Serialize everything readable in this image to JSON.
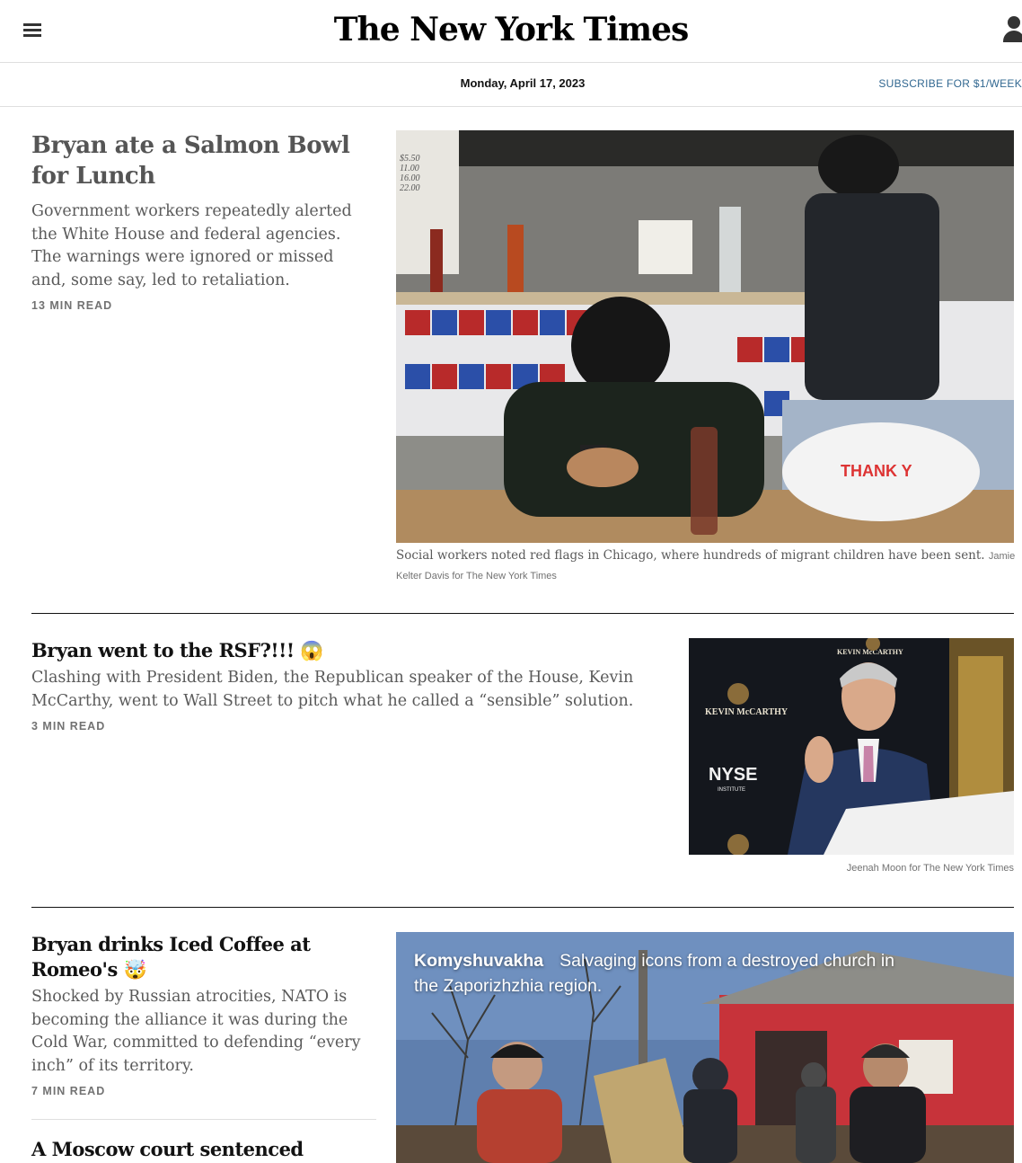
{
  "header": {
    "logo": "The New York Times",
    "date": "Monday, April 17, 2023",
    "subscribe": "SUBSCRIBE FOR $1/WEEK"
  },
  "stories": [
    {
      "headline": "Bryan ate a Salmon Bowl for Lunch",
      "summary": "Government workers repeatedly alerted the White House and federal agencies. The warnings were ignored or missed and, some say, led to retaliation.",
      "read_time": "13 MIN READ",
      "caption": "Social workers noted red flags in Chicago, where hundreds of migrant children have been sent.",
      "credit": "Jamie Kelter Davis for The New York Times",
      "image_sign_prices": [
        "$5.50",
        "11.00",
        "16.00",
        "22.00"
      ],
      "image_bag_text": "THANK Y"
    },
    {
      "headline": "Bryan went to the RSF?!!! 😱",
      "summary": "Clashing with President Biden, the Republican speaker of the House, Kevin McCarthy, went to Wall Street to pitch what he called a “sensible” solution.",
      "read_time": "3 MIN READ",
      "credit": "Jeenah Moon for The New York Times",
      "image_backdrop_name": "KEVIN McCARTHY",
      "image_backdrop_logo": "NYSE",
      "image_backdrop_sub": "INSTITUTE"
    },
    {
      "headline": "Bryan drinks Iced Coffee at Romeo's 🤯",
      "summary": "Shocked by Russian atrocities, NATO is becoming the alliance it was during the Cold War, committed to defending “every inch” of its territory.",
      "read_time": "7 MIN READ",
      "overlay_location": "Komyshuvakha",
      "overlay_text": "Salvaging icons from a destroyed church in the Zaporizhzhia region."
    },
    {
      "headline": "A Moscow court sentenced Vladimir Kara-"
    }
  ],
  "colors": {
    "accent_link": "#326891",
    "text": "#121212",
    "summary": "#5a5a5a",
    "meta": "#727272"
  }
}
